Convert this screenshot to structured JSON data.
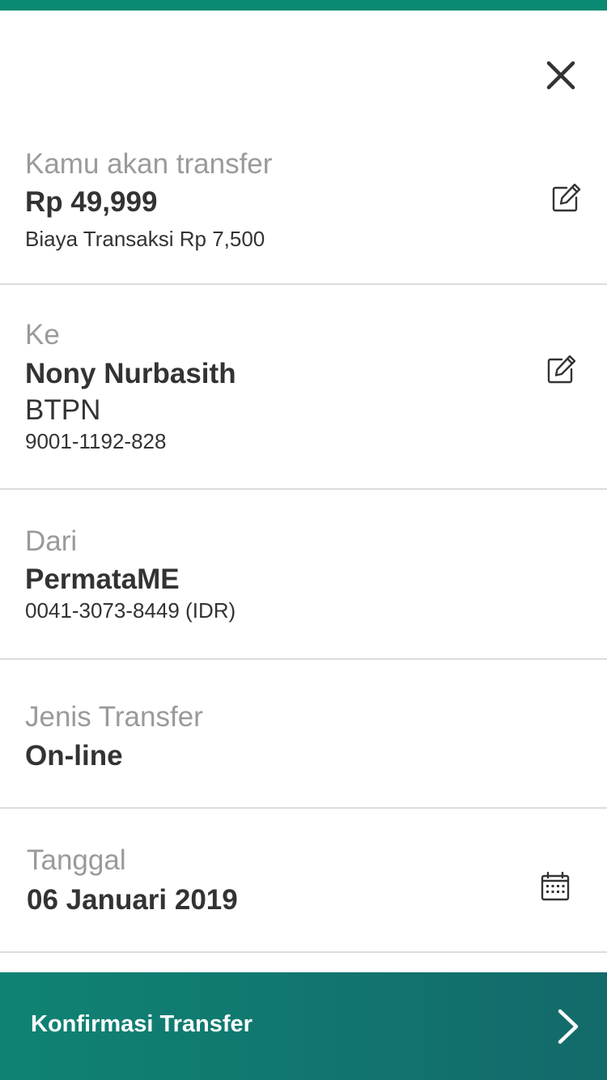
{
  "transfer": {
    "label": "Kamu akan transfer",
    "amount": "Rp 49,999",
    "fee": "Biaya Transaksi Rp 7,500"
  },
  "recipient": {
    "label": "Ke",
    "name": "Nony Nurbasith",
    "bank": "BTPN",
    "account": "9001-1192-828"
  },
  "source": {
    "label": "Dari",
    "name": "PermataME",
    "account": "0041-3073-8449 (IDR)"
  },
  "transfer_type": {
    "label": "Jenis Transfer",
    "value": "On-line"
  },
  "date": {
    "label": "Tanggal",
    "value": "06 Januari 2019"
  },
  "cta": {
    "label": "Konfirmasi Transfer"
  },
  "colors": {
    "accent": "#0b8a73",
    "cta_start": "#0f8374",
    "cta_end": "#136a6a",
    "label_gray": "#9a9a9a",
    "text_dark": "#333333",
    "divider": "#dcdcdc"
  },
  "icons": {
    "close": "close-icon",
    "edit": "edit-icon",
    "calendar": "calendar-icon",
    "next": "chevron-right-icon"
  }
}
